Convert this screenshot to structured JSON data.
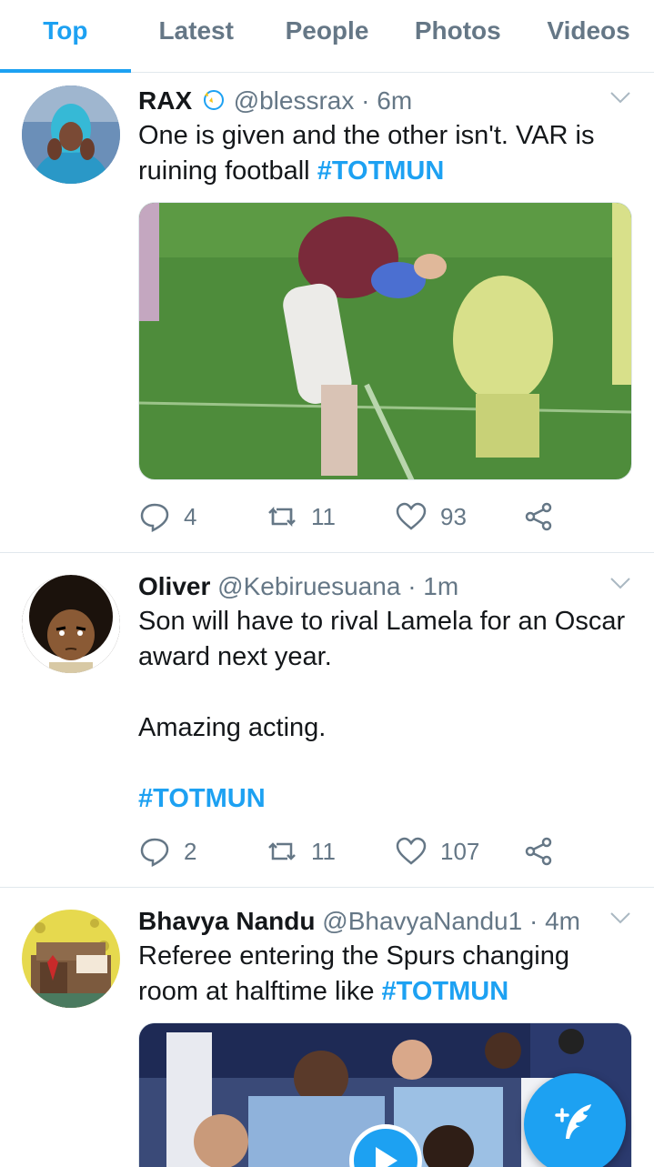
{
  "tabs": [
    {
      "label": "Top",
      "active": true
    },
    {
      "label": "Latest"
    },
    {
      "label": "People"
    },
    {
      "label": "Photos"
    },
    {
      "label": "Videos"
    }
  ],
  "tweets": [
    {
      "name": "RAX",
      "handle": "@blessrax",
      "time": "· 6m",
      "text": "One is given and the other isn't. VAR is ruining football ",
      "hashtag": "#TOTMUN",
      "replies": "4",
      "retweets": "11",
      "likes": "93"
    },
    {
      "name": "Oliver",
      "handle": "@Kebiruesuana",
      "time": "· 1m",
      "line1": "Son will have to rival Lamela for an Oscar award next year.",
      "line2": "Amazing acting.",
      "hashtag": "#TOTMUN",
      "replies": "2",
      "retweets": "11",
      "likes": "107"
    },
    {
      "name": "Bhavya Nandu",
      "handle": "@BhavyaNandu1",
      "time": "· 4m",
      "text": "Referee entering the Spurs changing room at halftime like ",
      "hashtag": "#TOTMUN"
    }
  ],
  "colors": {
    "accent": "#1da1f2",
    "secondary_text": "#657786"
  }
}
